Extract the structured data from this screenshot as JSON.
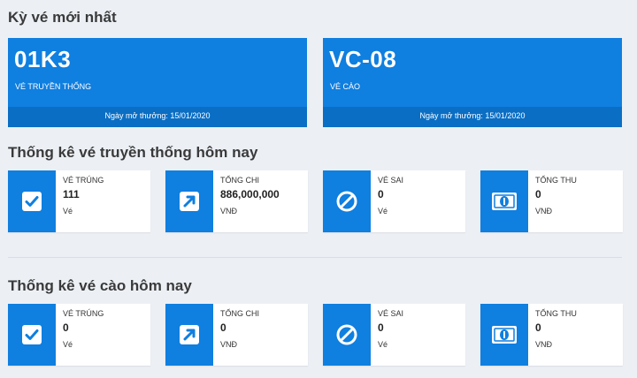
{
  "latest": {
    "title": "Kỳ vé mới nhất",
    "cards": [
      {
        "code": "01K3",
        "type": "VÉ TRUYỀN THỐNG",
        "footer": "Ngày mở thưởng: 15/01/2020"
      },
      {
        "code": "VC-08",
        "type": "VÉ CÀO",
        "footer": "Ngày mở thưởng: 15/01/2020"
      }
    ]
  },
  "traditional": {
    "title": "Thống kê vé truyền thống hôm nay",
    "stats": [
      {
        "icon": "check-square-icon",
        "label": "VÉ TRÚNG",
        "value": "111",
        "unit": "Vé"
      },
      {
        "icon": "arrow-up-right-icon",
        "label": "TỔNG CHI",
        "value": "886,000,000",
        "unit": "VNĐ"
      },
      {
        "icon": "ban-icon",
        "label": "VÉ SAI",
        "value": "0",
        "unit": "Vé"
      },
      {
        "icon": "money-bill-icon",
        "label": "TỔNG THU",
        "value": "0",
        "unit": "VNĐ"
      }
    ]
  },
  "scratch": {
    "title": "Thống kê vé cào hôm nay",
    "stats": [
      {
        "icon": "check-square-icon",
        "label": "VÉ TRÚNG",
        "value": "0",
        "unit": "Vé"
      },
      {
        "icon": "arrow-up-right-icon",
        "label": "TỔNG CHI",
        "value": "0",
        "unit": "VNĐ"
      },
      {
        "icon": "ban-icon",
        "label": "VÉ SAI",
        "value": "0",
        "unit": "Vé"
      },
      {
        "icon": "money-bill-icon",
        "label": "TỔNG THU",
        "value": "0",
        "unit": "VNĐ"
      }
    ]
  },
  "colors": {
    "accent": "#0f7fe0",
    "accent_dark": "#0a6ec4",
    "background": "#ecf0f5"
  }
}
